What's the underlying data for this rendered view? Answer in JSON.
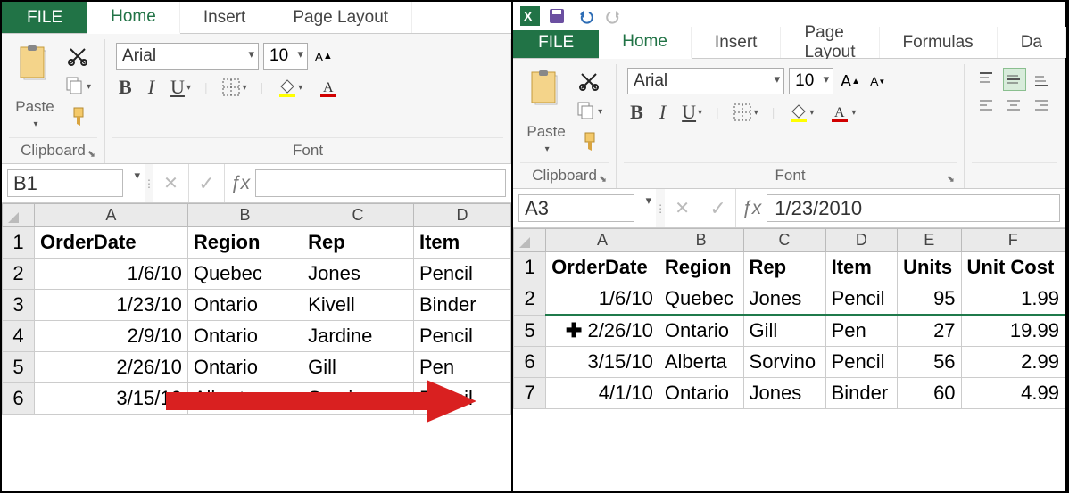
{
  "left": {
    "tabs": {
      "file": "FILE",
      "home": "Home",
      "insert": "Insert",
      "page_layout": "Page Layout"
    },
    "clipboard": {
      "paste": "Paste",
      "label": "Clipboard"
    },
    "font": {
      "name": "Arial",
      "size": "10",
      "bold": "B",
      "italic": "I",
      "underline": "U",
      "label": "Font"
    },
    "namebox": "B1",
    "formula": "",
    "grid": {
      "cols": [
        "A",
        "B",
        "C",
        "D"
      ],
      "headers": [
        "OrderDate",
        "Region",
        "Rep",
        "Item"
      ],
      "rows": [
        [
          "1/6/10",
          "Quebec",
          "Jones",
          "Pencil"
        ],
        [
          "1/23/10",
          "Ontario",
          "Kivell",
          "Binder"
        ],
        [
          "2/9/10",
          "Ontario",
          "Jardine",
          "Pencil"
        ],
        [
          "2/26/10",
          "Ontario",
          "Gill",
          "Pen"
        ],
        [
          "3/15/10",
          "Alberta",
          "Sorvino",
          "Pencil"
        ]
      ]
    }
  },
  "right": {
    "tabs": {
      "file": "FILE",
      "home": "Home",
      "insert": "Insert",
      "page_layout": "Page Layout",
      "formulas": "Formulas",
      "data": "Da"
    },
    "clipboard": {
      "paste": "Paste",
      "label": "Clipboard"
    },
    "font": {
      "name": "Arial",
      "size": "10",
      "bold": "B",
      "italic": "I",
      "underline": "U",
      "label": "Font"
    },
    "namebox": "A3",
    "formula": "1/23/2010",
    "grid": {
      "cols": [
        "A",
        "B",
        "C",
        "D",
        "E",
        "F"
      ],
      "headers": [
        "OrderDate",
        "Region",
        "Rep",
        "Item",
        "Units",
        "Unit Cost"
      ],
      "rows": [
        {
          "n": "2",
          "cells": [
            "1/6/10",
            "Quebec",
            "Jones",
            "Pencil",
            "95",
            "1.99"
          ]
        },
        {
          "n": "5",
          "cells": [
            "2/26/10",
            "Ontario",
            "Gill",
            "Pen",
            "27",
            "19.99"
          ]
        },
        {
          "n": "6",
          "cells": [
            "3/15/10",
            "Alberta",
            "Sorvino",
            "Pencil",
            "56",
            "2.99"
          ]
        },
        {
          "n": "7",
          "cells": [
            "4/1/10",
            "Ontario",
            "Jones",
            "Binder",
            "60",
            "4.99"
          ]
        }
      ]
    }
  }
}
